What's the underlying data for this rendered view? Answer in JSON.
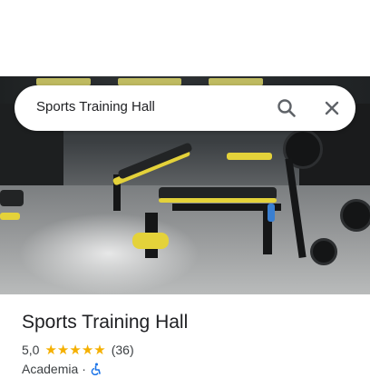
{
  "search": {
    "query": "Sports Training Hall",
    "search_icon": "search-icon",
    "clear_icon": "close-icon"
  },
  "place": {
    "title": "Sports Training Hall",
    "rating": "5,0",
    "stars": 5,
    "reviews": "(36)",
    "category": "Academia",
    "separator": "·",
    "accessibility_icon": "wheelchair-accessible-icon"
  },
  "colors": {
    "star": "#f5b000",
    "text": "#202124",
    "secondary_text": "#3c4043",
    "accessibility_blue": "#1a73e8"
  }
}
